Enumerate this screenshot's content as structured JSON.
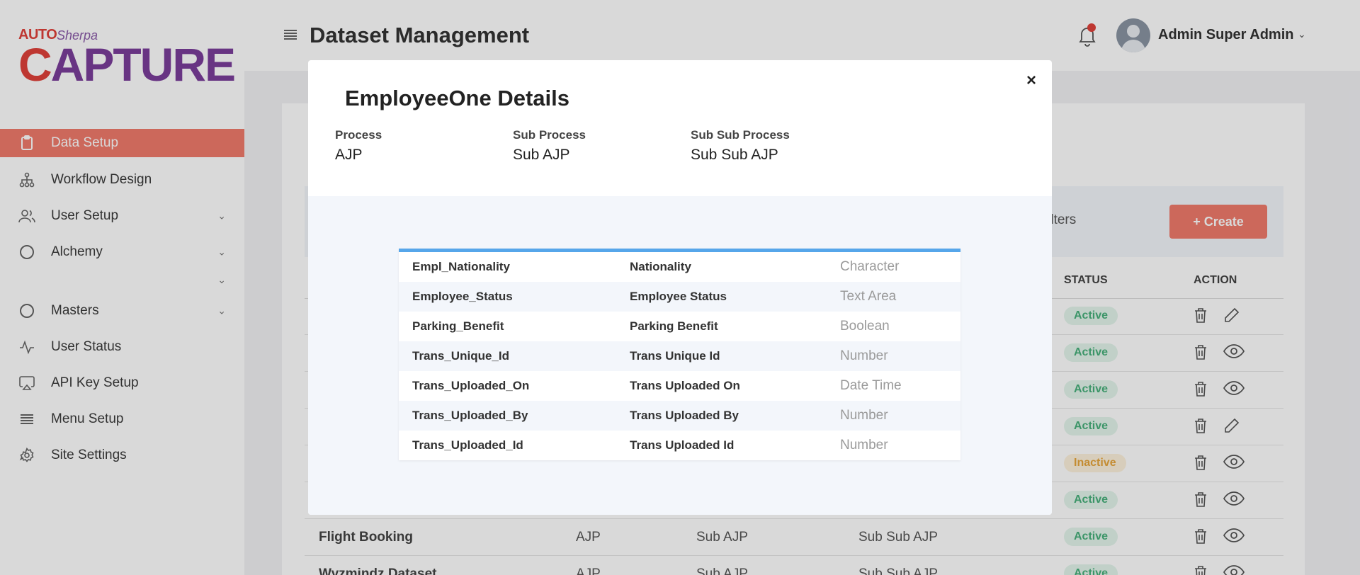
{
  "logo": {
    "auto": "AUTO",
    "sherpa": "Sherpa",
    "capture_c": "C",
    "capture_rest": "APTURE"
  },
  "sidebar": {
    "items": [
      {
        "label": "Data Setup",
        "icon": "clipboard-icon",
        "active": true
      },
      {
        "label": "Workflow Design",
        "icon": "workflow-icon"
      },
      {
        "label": "User Setup",
        "icon": "users-icon",
        "chevron": true
      },
      {
        "label": "Alchemy",
        "icon": "circle-icon",
        "chevron": true
      },
      {
        "label": "Masters",
        "icon": "circle-icon",
        "chevron": true
      },
      {
        "label": "User Status",
        "icon": "activity-icon"
      },
      {
        "label": "API Key Setup",
        "icon": "airplay-icon"
      },
      {
        "label": "Menu Setup",
        "icon": "list-icon"
      },
      {
        "label": "Site Settings",
        "icon": "gear-icon"
      }
    ]
  },
  "header": {
    "title": "Dataset Management",
    "user_name": "Admin Super Admin"
  },
  "background": {
    "clear_filters": "ar All Filters",
    "create_label": "+ Create",
    "col_status": "STATUS",
    "col_action": "ACTION",
    "rows": [
      {
        "name": "",
        "c1": "",
        "c2": "",
        "c3": "",
        "status": "Active",
        "action2": "edit"
      },
      {
        "name": "",
        "c1": "",
        "c2": "",
        "c3": "",
        "status": "Active",
        "action2": "view"
      },
      {
        "name": "",
        "c1": "",
        "c2": "",
        "c3": "",
        "status": "Active",
        "action2": "view"
      },
      {
        "name": "",
        "c1": "",
        "c2": "",
        "c3": "",
        "status": "Active",
        "action2": "edit"
      },
      {
        "name": "",
        "c1": "",
        "c2": "",
        "c3": "",
        "status": "Inactive",
        "action2": "view"
      },
      {
        "name": "",
        "c1": "",
        "c2": "",
        "c3": "",
        "status": "Active",
        "action2": "view"
      },
      {
        "name": "Flight Booking",
        "c1": "AJP",
        "c2": "Sub AJP",
        "c3": "Sub Sub AJP",
        "status": "Active",
        "action2": "view"
      },
      {
        "name": "Wyzmindz Dataset",
        "c1": "AJP",
        "c2": "Sub AJP",
        "c3": "Sub Sub AJP",
        "status": "Active",
        "action2": "view"
      }
    ]
  },
  "modal": {
    "title": "EmployeeOne Details",
    "close": "×",
    "process_label": "Process",
    "process_value": "AJP",
    "sub_process_label": "Sub Process",
    "sub_process_value": "Sub AJP",
    "sub_sub_process_label": "Sub Sub Process",
    "sub_sub_process_value": "Sub Sub AJP",
    "fields": [
      {
        "key": "Empl_Nationality",
        "label": "Nationality",
        "type": "Character"
      },
      {
        "key": "Employee_Status",
        "label": "Employee Status",
        "type": "Text Area"
      },
      {
        "key": "Parking_Benefit",
        "label": "Parking Benefit",
        "type": "Boolean"
      },
      {
        "key": "Trans_Unique_Id",
        "label": "Trans Unique Id",
        "type": "Number"
      },
      {
        "key": "Trans_Uploaded_On",
        "label": "Trans Uploaded On",
        "type": "Date Time"
      },
      {
        "key": "Trans_Uploaded_By",
        "label": "Trans Uploaded By",
        "type": "Number"
      },
      {
        "key": "Trans_Uploaded_Id",
        "label": "Trans Uploaded Id",
        "type": "Number"
      }
    ]
  },
  "colors": {
    "accent": "#f07b6c",
    "table_top": "#56a6ea",
    "active_badge": "#47b07b",
    "inactive_badge": "#e7a53b"
  }
}
